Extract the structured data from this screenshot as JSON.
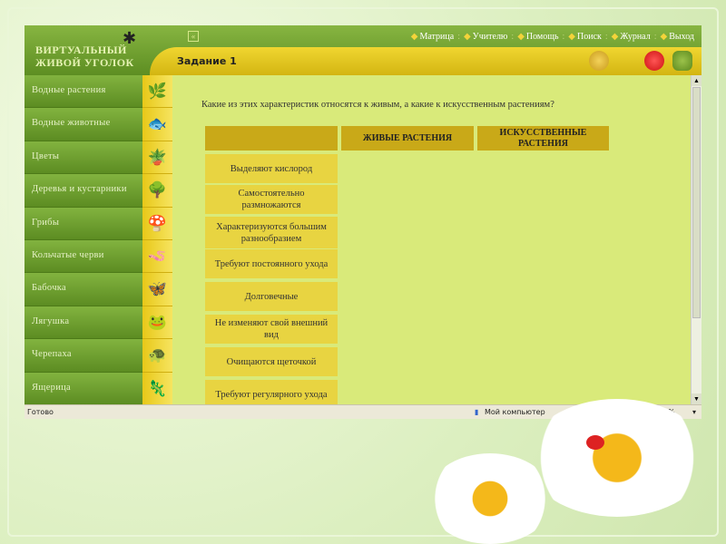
{
  "app": {
    "logo_line1": "ВИРТУАЛЬНЫЙ",
    "logo_line2": "ЖИВОЙ УГОЛОК"
  },
  "topnav": [
    {
      "icon": "matrix-icon",
      "label": "Матрица"
    },
    {
      "icon": "teacher-icon",
      "label": "Учителю"
    },
    {
      "icon": "help-icon",
      "label": "Помощь"
    },
    {
      "icon": "search-icon",
      "label": "Поиск"
    },
    {
      "icon": "journal-icon",
      "label": "Журнал"
    },
    {
      "icon": "exit-icon",
      "label": "Выход"
    }
  ],
  "task_title": "Задание 1",
  "sidebar": [
    {
      "label": "Водные растения",
      "icon": "🌿"
    },
    {
      "label": "Водные животные",
      "icon": "🐟"
    },
    {
      "label": "Цветы",
      "icon": "🪴"
    },
    {
      "label": "Деревья и кустарники",
      "icon": "🌳"
    },
    {
      "label": "Грибы",
      "icon": "🍄"
    },
    {
      "label": "Кольчатые черви",
      "icon": "🪱"
    },
    {
      "label": "Бабочка",
      "icon": "🦋"
    },
    {
      "label": "Лягушка",
      "icon": "🐸"
    },
    {
      "label": "Черепаха",
      "icon": "🐢"
    },
    {
      "label": "Ящерица",
      "icon": "🦎"
    }
  ],
  "question": "Какие из этих характеристик относятся к живым, а какие к искусственным растениям?",
  "columns": {
    "live": "ЖИВЫЕ РАСТЕНИЯ",
    "artificial": "ИСКУССТВЕННЫЕ РАСТЕНИЯ"
  },
  "items": [
    "Выделяют кислород",
    "Самостоятельно размножаются",
    "Характеризуются большим разнообразием",
    "Требуют постоянного ухода",
    "Долговечные",
    "Не изменяют свой внешний вид",
    "Очищаются щеточкой",
    "Требуют регулярного ухода"
  ],
  "status": {
    "left": "Готово",
    "zone": "Мой компьютер",
    "zoom": "100%"
  },
  "colors": {
    "accent": "#c9a918",
    "content": "#d9ea7a",
    "sidebar": "#6e9f30"
  }
}
